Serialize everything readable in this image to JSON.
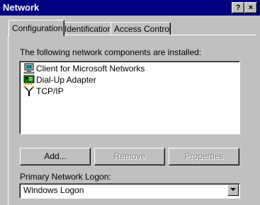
{
  "window": {
    "title": "Network",
    "help_label": "?",
    "close_label": "×"
  },
  "tabs": [
    {
      "label": "Configuration",
      "active": true
    },
    {
      "label": "Identification",
      "active": false
    },
    {
      "label": "Access Control",
      "active": false
    }
  ],
  "components": {
    "label": "The following network components are installed:",
    "items": [
      {
        "label": "Client for Microsoft Networks",
        "icon": "network-client-icon"
      },
      {
        "label": "Dial-Up Adapter",
        "icon": "network-adapter-icon"
      },
      {
        "label": "TCP/IP",
        "icon": "protocol-icon"
      }
    ]
  },
  "buttons": {
    "add": "Add...",
    "remove": "Remove",
    "properties": "Properties"
  },
  "logon": {
    "label": "Primary Network Logon:",
    "value": "Windows Logon"
  },
  "colors": {
    "titlebar": "#000080",
    "face": "#c0c0c0",
    "disabled_text": "#808080"
  }
}
